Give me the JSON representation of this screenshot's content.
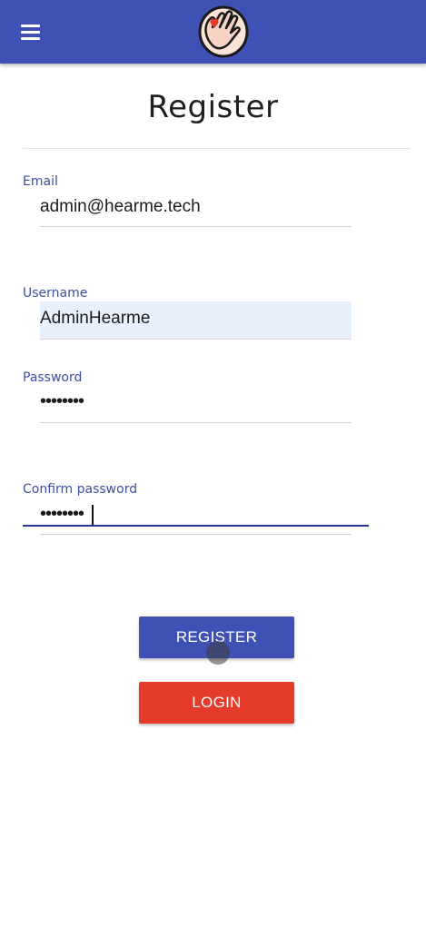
{
  "header": {
    "menu_icon": "hamburger-menu-icon",
    "logo_icon": "waving-hand-heart-logo",
    "accent_color": "#3f51b5"
  },
  "page": {
    "title": "Register"
  },
  "form": {
    "email": {
      "label": "Email",
      "value": "admin@hearme.tech"
    },
    "username": {
      "label": "Username",
      "value": "AdminHearme"
    },
    "password": {
      "label": "Password",
      "value": "••••••••"
    },
    "confirm_password": {
      "label": "Confirm password",
      "value": "••••••••"
    }
  },
  "buttons": {
    "register_label": "REGISTER",
    "register_color": "#3f51b5",
    "login_label": "LOGIN",
    "login_color": "#e53b2b"
  }
}
